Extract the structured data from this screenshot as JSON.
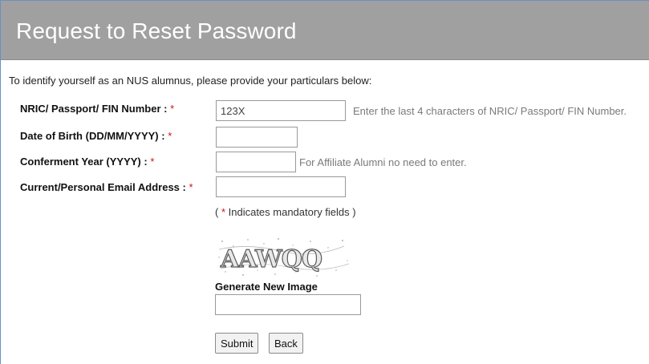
{
  "header": {
    "title": "Request to Reset Password"
  },
  "intro": "To identify yourself as an NUS alumnus, please provide your particulars below:",
  "form": {
    "nric": {
      "label": "NRIC/ Passport/ FIN Number :",
      "required_mark": "*",
      "value": "123X",
      "hint": "Enter the last 4 characters of NRIC/ Passport/ FIN Number."
    },
    "dob": {
      "label": "Date of Birth (DD/MM/YYYY) :",
      "required_mark": "*",
      "value": ""
    },
    "conferment": {
      "label": "Conferment Year (YYYY) :",
      "required_mark": "*",
      "value": "",
      "hint": "For Affiliate Alumni no need to enter."
    },
    "email": {
      "label": "Current/Personal Email Address :",
      "required_mark": "*",
      "value": ""
    },
    "mandatory_note": {
      "open": "( ",
      "mark": "*",
      "text": " Indicates mandatory fields )"
    },
    "captcha": {
      "image_text": "AAWQQ",
      "generate_label": "Generate New Image",
      "value": ""
    },
    "buttons": {
      "submit": "Submit",
      "back": "Back"
    }
  },
  "colors": {
    "header_bg": "#a0a0a0",
    "required": "#d01010",
    "hint": "#7a7a7a"
  }
}
